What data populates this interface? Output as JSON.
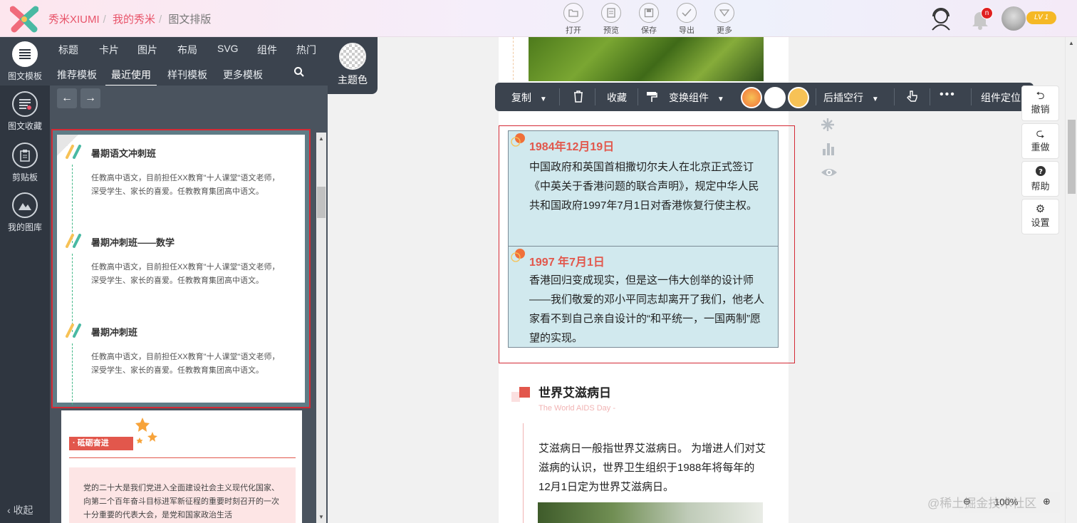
{
  "header": {
    "brand": "秀米XIUMI",
    "breadcrumb": [
      "我的秀米",
      "图文排版"
    ],
    "toolbar": [
      {
        "label": "打开",
        "icon": "folder-icon"
      },
      {
        "label": "预览",
        "icon": "preview-icon"
      },
      {
        "label": "保存",
        "icon": "save-icon"
      },
      {
        "label": "导出",
        "icon": "export-check-icon"
      },
      {
        "label": "更多",
        "icon": "chevron-down-icon"
      }
    ],
    "notification_count": "n",
    "level_badge": "LV 1"
  },
  "rail": {
    "items": [
      {
        "label": "图文模板",
        "icon": "template-list-icon",
        "active": true
      },
      {
        "label": "图文收藏",
        "icon": "favorites-list-icon"
      },
      {
        "label": "剪贴板",
        "icon": "clipboard-icon"
      },
      {
        "label": "我的图库",
        "icon": "image-library-icon"
      }
    ],
    "collapse": "收起"
  },
  "categories": {
    "row1": [
      "标题",
      "卡片",
      "图片",
      "布局",
      "SVG",
      "组件",
      "热门"
    ],
    "row2": [
      "推荐模板",
      "最近使用",
      "样刊模板",
      "更多模板"
    ],
    "active": "最近使用"
  },
  "theme_color": {
    "label": "主题色"
  },
  "template_card": {
    "items": [
      {
        "title": "暑期语文冲刺班",
        "text": "任教高中语文，目前担任XX教育\"十人课堂\"语文老师，深受学生、家长的喜爱。任教教育集团高中语文。"
      },
      {
        "title": "暑期冲刺班——数学",
        "text": "任教高中语文，目前担任XX教育\"十人课堂\"语文老师，深受学生、家长的喜爱。任教教育集团高中语文。"
      },
      {
        "title": "暑期冲刺班",
        "text": "任教高中语文，目前担任XX教育\"十人课堂\"语文老师，深受学生、家长的喜爱。任教教育集团高中语文。"
      }
    ]
  },
  "template_card2": {
    "tag": "· 砥砺奋进",
    "text": "党的二十大是我们党进入全面建设社会主义现代化国家、向第二个百年奋斗目标进军新征程的重要时刻召开的一次十分重要的代表大会，是党和国家政治生活"
  },
  "float_toolbar": {
    "copy": "复制",
    "collect": "收藏",
    "transform": "变换组件",
    "insert_after": "后插空行",
    "more": "•••",
    "locate": "组件定位",
    "swatches": [
      "#f0703a",
      "#ffffff",
      "#f7c256"
    ]
  },
  "document": {
    "timeline": [
      {
        "date": "1984年12月19日",
        "text": "中国政府和英国首相撒切尔夫人在北京正式签订《中英关于香港问题的联合声明》，规定中华人民共和国政府1997年7月1日对香港恢复行使主权。"
      },
      {
        "date": "1997 年7月1日",
        "text": "香港回归变成现实，但是这一伟大创举的设计师——我们敬爱的邓小平同志却离开了我们，他老人家看不到自己亲自设计的“和平统一，一国两制”愿望的实现。"
      }
    ],
    "section": {
      "title": "世界艾滋病日",
      "subtitle": "The World AIDS Day  -",
      "body": "艾滋病日一般指世界艾滋病日。 为增进人们对艾滋病的认识，世界卫生组织于1988年将每年的12月1日定为世界艾滋病日。"
    }
  },
  "right_buttons": [
    {
      "label": "撤销",
      "icon": "undo-icon"
    },
    {
      "label": "重做",
      "icon": "redo-icon"
    },
    {
      "label": "帮助",
      "icon": "help-icon"
    },
    {
      "label": "设置",
      "icon": "settings-icon"
    }
  ],
  "zoom": {
    "value": "100%"
  },
  "watermark": "@稀土掘金技术社区"
}
